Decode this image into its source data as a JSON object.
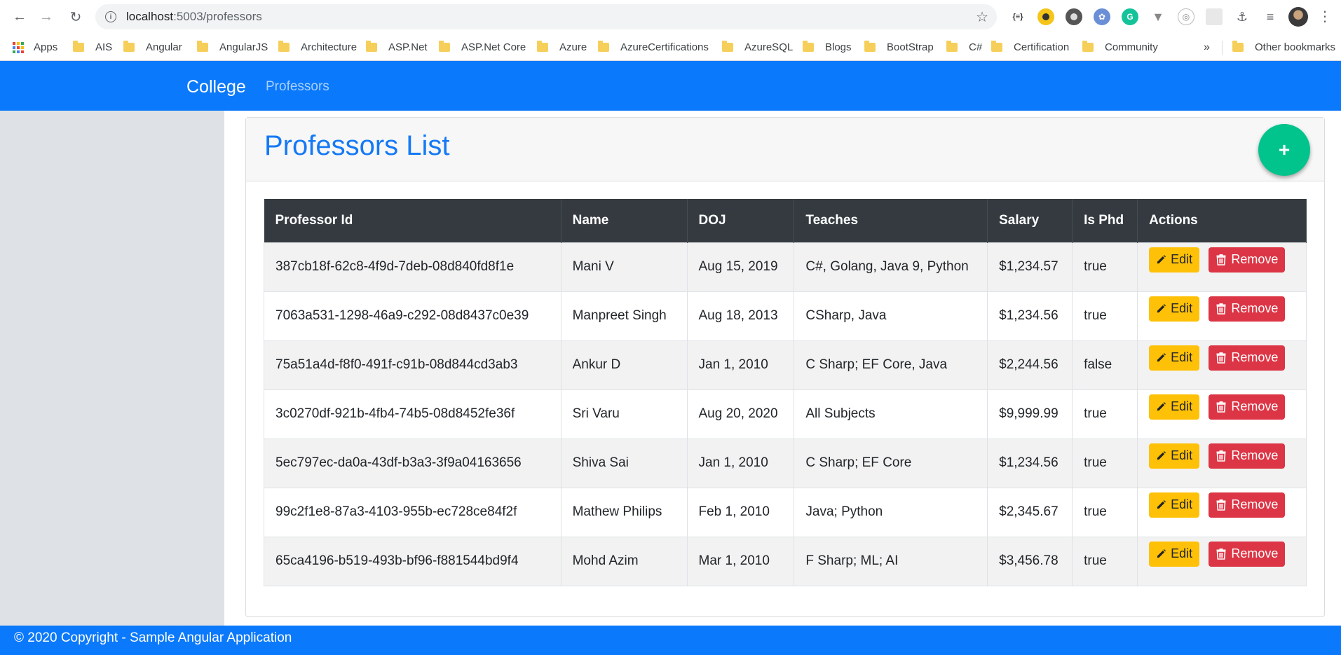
{
  "browser": {
    "url_host": "localhost",
    "url_path": ":5003/professors",
    "bookmarks": [
      "Apps",
      "AIS",
      "Angular",
      "AngularJS",
      "Architecture",
      "ASP.Net",
      "ASP.Net Core",
      "Azure",
      "AzureCertifications",
      "AzureSQL",
      "Blogs",
      "BootStrap",
      "C#",
      "Certification",
      "Community"
    ],
    "more": "»",
    "other_bookmarks": "Other bookmarks",
    "ext_json_label": "{≡}"
  },
  "app": {
    "brand": "College",
    "nav_link": "Professors",
    "page_title": "Professors List",
    "add_button": "+",
    "footer": "© 2020 Copyright - Sample Angular Application"
  },
  "table": {
    "headers": [
      "Professor Id",
      "Name",
      "DOJ",
      "Teaches",
      "Salary",
      "Is Phd",
      "Actions"
    ],
    "edit_label": "Edit",
    "remove_label": "Remove",
    "rows": [
      {
        "id": "387cb18f-62c8-4f9d-7deb-08d840fd8f1e",
        "name": "Mani V",
        "doj": "Aug 15, 2019",
        "teaches": "C#, Golang, Java 9, Python",
        "salary": "$1,234.57",
        "phd": "true"
      },
      {
        "id": "7063a531-1298-46a9-c292-08d8437c0e39",
        "name": "Manpreet Singh",
        "doj": "Aug 18, 2013",
        "teaches": "CSharp, Java",
        "salary": "$1,234.56",
        "phd": "true"
      },
      {
        "id": "75a51a4d-f8f0-491f-c91b-08d844cd3ab3",
        "name": "Ankur D",
        "doj": "Jan 1, 2010",
        "teaches": "C Sharp; EF Core, Java",
        "salary": "$2,244.56",
        "phd": "false"
      },
      {
        "id": "3c0270df-921b-4fb4-74b5-08d8452fe36f",
        "name": "Sri Varu",
        "doj": "Aug 20, 2020",
        "teaches": "All Subjects",
        "salary": "$9,999.99",
        "phd": "true"
      },
      {
        "id": "5ec797ec-da0a-43df-b3a3-3f9a04163656",
        "name": "Shiva Sai",
        "doj": "Jan 1, 2010",
        "teaches": "C Sharp; EF Core",
        "salary": "$1,234.56",
        "phd": "true"
      },
      {
        "id": "99c2f1e8-87a3-4103-955b-ec728ce84f2f",
        "name": "Mathew Philips",
        "doj": "Feb 1, 2010",
        "teaches": "Java; Python",
        "salary": "$2,345.67",
        "phd": "true"
      },
      {
        "id": "65ca4196-b519-493b-bf96-f881544bd9f4",
        "name": "Mohd Azim",
        "doj": "Mar 1, 2010",
        "teaches": "F Sharp; ML; AI",
        "salary": "$3,456.78",
        "phd": "true"
      }
    ]
  },
  "colors": {
    "navbar": "#0b79fb",
    "title": "#1479f5",
    "fab": "#00c48c",
    "edit": "#ffc107",
    "remove": "#dc3545",
    "table_header": "#343a40"
  }
}
